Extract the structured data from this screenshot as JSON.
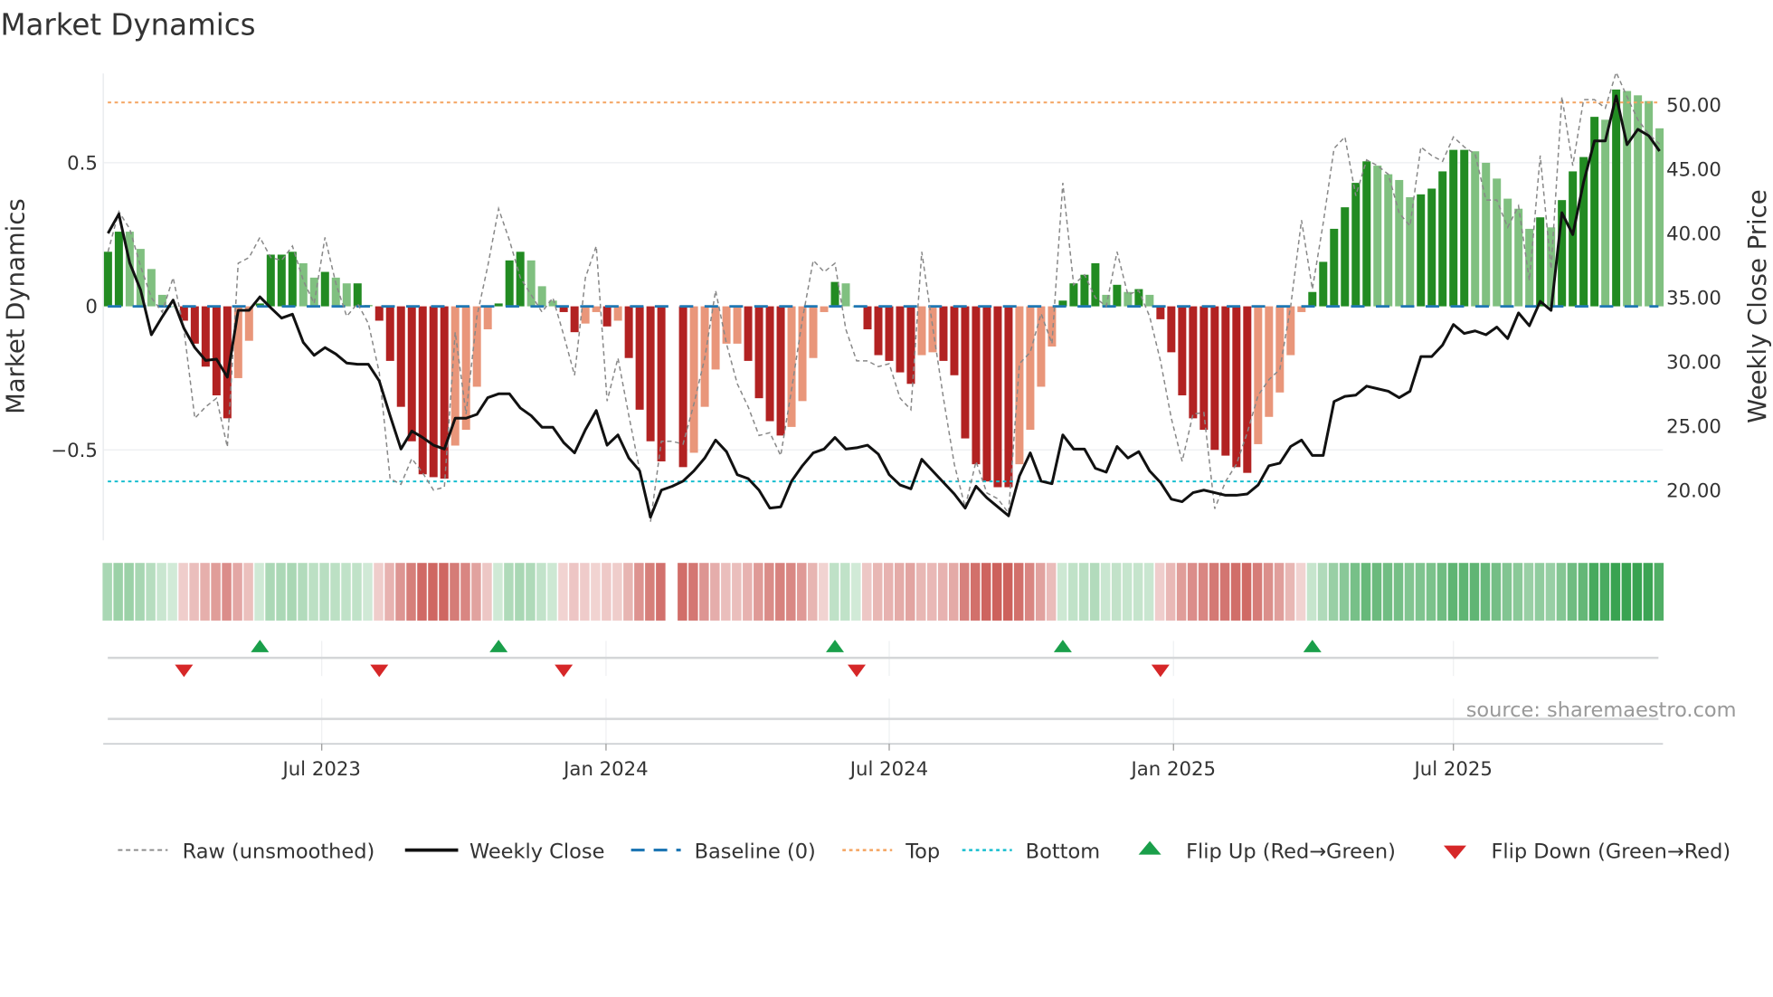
{
  "chart_data": {
    "type": "bar",
    "title": "Market Dynamics",
    "ylabel_left": "Market Dynamics",
    "ylabel_right": "Weekly Close Price",
    "left_ylim": [
      -0.81,
      0.81
    ],
    "right_ylim": [
      16.0,
      53.3
    ],
    "left_ticks": [
      {
        "value": 0.5,
        "label": "0.5"
      },
      {
        "value": 0,
        "label": "0"
      },
      {
        "value": -0.5,
        "label": "−0.5"
      }
    ],
    "right_ticks": [
      {
        "value": 50,
        "label": "50.00"
      },
      {
        "value": 45,
        "label": "45.00"
      },
      {
        "value": 40,
        "label": "40.00"
      },
      {
        "value": 35,
        "label": "35.00"
      },
      {
        "value": 30,
        "label": "30.00"
      },
      {
        "value": 25,
        "label": "25.00"
      },
      {
        "value": 20,
        "label": "20.00"
      }
    ],
    "x_ticks": [
      {
        "week": 19.7,
        "label": "Jul 2023"
      },
      {
        "week": 45.9,
        "label": "Jan 2024"
      },
      {
        "week": 72.0,
        "label": "Jul 2024"
      },
      {
        "week": 98.2,
        "label": "Jan 2025"
      },
      {
        "week": 124.0,
        "label": "Jul 2025"
      }
    ],
    "top_threshold": 0.71,
    "bottom_threshold": -0.61,
    "baseline": 0,
    "grid": true,
    "legend_position": "bottom",
    "momentum": [
      0.19,
      0.26,
      0.26,
      0.2,
      0.13,
      0.04,
      0.0,
      -0.05,
      -0.13,
      -0.21,
      -0.31,
      -0.39,
      -0.25,
      -0.12,
      0.01,
      0.18,
      0.18,
      0.19,
      0.15,
      0.1,
      0.12,
      0.1,
      0.08,
      0.08,
      0.005,
      -0.05,
      -0.19,
      -0.35,
      -0.47,
      -0.585,
      -0.595,
      -0.6,
      -0.485,
      -0.43,
      -0.28,
      -0.08,
      0.01,
      0.16,
      0.19,
      0.16,
      0.07,
      0.02,
      -0.02,
      -0.09,
      -0.06,
      -0.02,
      -0.07,
      -0.05,
      -0.18,
      -0.36,
      -0.47,
      -0.54,
      null,
      -0.56,
      -0.51,
      -0.35,
      -0.22,
      -0.13,
      -0.13,
      -0.19,
      -0.32,
      -0.4,
      -0.45,
      -0.42,
      -0.33,
      -0.18,
      -0.02,
      0.085,
      0.08,
      0.0,
      -0.08,
      -0.17,
      -0.19,
      -0.23,
      -0.27,
      -0.17,
      -0.16,
      -0.19,
      -0.24,
      -0.46,
      -0.55,
      -0.61,
      -0.63,
      -0.63,
      -0.55,
      -0.43,
      -0.28,
      -0.14,
      0.02,
      0.08,
      0.11,
      0.15,
      0.04,
      0.075,
      0.05,
      0.06,
      0.04,
      -0.045,
      -0.16,
      -0.31,
      -0.39,
      -0.43,
      -0.5,
      -0.52,
      -0.56,
      -0.58,
      -0.48,
      -0.385,
      -0.3,
      -0.17,
      -0.02,
      0.05,
      0.155,
      0.27,
      0.345,
      0.43,
      0.505,
      0.49,
      0.46,
      0.44,
      0.38,
      0.39,
      0.41,
      0.47,
      0.545,
      0.545,
      0.54,
      0.5,
      0.445,
      0.375,
      0.34,
      0.27,
      0.31,
      0.275,
      0.37,
      0.47,
      0.52,
      0.66,
      0.65,
      0.755,
      0.75,
      0.735,
      0.715,
      0.62
    ],
    "bar_shade": [
      "dg",
      "dg",
      "lg",
      "lg",
      "lg",
      "lg",
      "lg",
      "dr",
      "dr",
      "dr",
      "dr",
      "dr",
      "lr",
      "lr",
      "dg",
      "dg",
      "dg",
      "dg",
      "lg",
      "lg",
      "dg",
      "lg",
      "lg",
      "dg",
      "lg",
      "dr",
      "dr",
      "dr",
      "dr",
      "dr",
      "dr",
      "dr",
      "lr",
      "lr",
      "lr",
      "lr",
      "dg",
      "dg",
      "dg",
      "lg",
      "lg",
      "lg",
      "dr",
      "dr",
      "lr",
      "lr",
      "dr",
      "lr",
      "dr",
      "dr",
      "dr",
      "dr",
      null,
      "dr",
      "lr",
      "lr",
      "lr",
      "lr",
      "lr",
      "dr",
      "dr",
      "dr",
      "dr",
      "lr",
      "lr",
      "lr",
      "lr",
      "dg",
      "lg",
      "lg",
      "dr",
      "dr",
      "dr",
      "dr",
      "dr",
      "lr",
      "lr",
      "dr",
      "dr",
      "dr",
      "dr",
      "dr",
      "dr",
      "dr",
      "lr",
      "lr",
      "lr",
      "lr",
      "dg",
      "dg",
      "dg",
      "dg",
      "lg",
      "dg",
      "lg",
      "dg",
      "lg",
      "dr",
      "dr",
      "dr",
      "dr",
      "dr",
      "dr",
      "dr",
      "dr",
      "dr",
      "lr",
      "lr",
      "lr",
      "lr",
      "lr",
      "dg",
      "dg",
      "dg",
      "dg",
      "dg",
      "dg",
      "lg",
      "lg",
      "lg",
      "lg",
      "dg",
      "dg",
      "dg",
      "dg",
      "dg",
      "lg",
      "lg",
      "lg",
      "lg",
      "lg",
      "lg",
      "dg",
      "lg",
      "dg",
      "dg",
      "dg",
      "dg",
      "lg",
      "dg",
      "lg",
      "lg",
      "lg",
      "lg"
    ],
    "raw": [
      0.19,
      0.33,
      0.27,
      0.14,
      0.03,
      -0.02,
      0.1,
      -0.08,
      -0.39,
      -0.35,
      -0.32,
      -0.49,
      0.15,
      0.17,
      0.24,
      0.17,
      0.16,
      0.21,
      0.09,
      0.01,
      0.24,
      0.08,
      -0.035,
      0.01,
      -0.06,
      -0.23,
      -0.6,
      -0.62,
      -0.53,
      -0.58,
      -0.64,
      -0.63,
      -0.09,
      -0.375,
      -0.035,
      0.14,
      0.34,
      0.23,
      0.1,
      0.04,
      -0.02,
      0.03,
      -0.1,
      -0.24,
      0.1,
      0.21,
      -0.33,
      -0.18,
      -0.38,
      -0.57,
      -0.75,
      -0.47,
      -0.47,
      -0.48,
      -0.34,
      -0.18,
      0.055,
      -0.13,
      -0.27,
      -0.35,
      -0.45,
      -0.44,
      -0.52,
      -0.29,
      -0.045,
      0.16,
      0.12,
      0.15,
      -0.08,
      -0.19,
      -0.19,
      -0.21,
      -0.2,
      -0.32,
      -0.36,
      0.19,
      -0.07,
      -0.32,
      -0.55,
      -0.7,
      -0.54,
      -0.65,
      -0.67,
      -0.72,
      -0.2,
      -0.16,
      -0.025,
      -0.13,
      0.43,
      0.075,
      0.11,
      0.03,
      0.0,
      0.19,
      0.04,
      0.055,
      -0.035,
      -0.19,
      -0.39,
      -0.54,
      -0.375,
      -0.37,
      -0.705,
      -0.61,
      -0.55,
      -0.44,
      -0.31,
      -0.255,
      -0.22,
      0.0,
      0.3,
      0.06,
      0.29,
      0.55,
      0.59,
      0.385,
      0.51,
      0.49,
      0.46,
      0.325,
      0.28,
      0.555,
      0.525,
      0.505,
      0.59,
      0.555,
      0.53,
      0.37,
      0.37,
      0.275,
      0.35,
      0.09,
      0.525,
      0.13,
      0.73,
      0.49,
      0.72,
      0.72,
      0.69,
      0.815,
      0.73,
      0.65,
      0.6,
      0.565
    ],
    "weekly_close": [
      40.0,
      41.5,
      37.7,
      35.6,
      32.1,
      33.5,
      34.8,
      32.6,
      31.1,
      30.1,
      30.2,
      28.8,
      34.0,
      34.0,
      35.05,
      34.2,
      33.4,
      33.7,
      31.5,
      30.5,
      31.1,
      30.6,
      29.9,
      29.8,
      29.8,
      28.5,
      25.8,
      23.2,
      24.6,
      24.1,
      23.5,
      23.2,
      25.6,
      25.6,
      25.9,
      27.2,
      27.5,
      27.5,
      26.4,
      25.8,
      24.9,
      24.9,
      23.7,
      22.9,
      24.7,
      26.2,
      23.5,
      24.3,
      22.5,
      21.5,
      17.9,
      20.0,
      20.3,
      20.7,
      21.5,
      22.5,
      23.9,
      23.0,
      21.2,
      20.9,
      20.0,
      18.6,
      18.7,
      20.7,
      21.9,
      22.9,
      23.2,
      24.1,
      23.2,
      23.3,
      23.5,
      22.8,
      21.2,
      20.4,
      20.1,
      22.4,
      21.5,
      20.6,
      19.7,
      18.6,
      20.3,
      19.4,
      18.7,
      18.0,
      21.1,
      22.9,
      20.7,
      20.5,
      24.3,
      23.2,
      23.2,
      21.7,
      21.4,
      23.4,
      22.5,
      23.0,
      21.5,
      20.6,
      19.3,
      19.1,
      19.8,
      20.0,
      19.8,
      19.6,
      19.6,
      19.7,
      20.4,
      21.9,
      22.1,
      23.4,
      23.9,
      22.7,
      22.7,
      26.9,
      27.3,
      27.4,
      28.1,
      27.9,
      27.7,
      27.2,
      27.7,
      30.4,
      30.4,
      31.3,
      32.9,
      32.2,
      32.4,
      32.1,
      32.7,
      31.8,
      33.8,
      32.8,
      34.7,
      34.0,
      41.6,
      39.9,
      44.0,
      47.2,
      47.2,
      50.7,
      46.9,
      48.1,
      47.6,
      46.4
    ],
    "flips_up": [
      14,
      36,
      67,
      88,
      111
    ],
    "flips_down": [
      7,
      25,
      42,
      69,
      97
    ],
    "colors": {
      "dark_green": "#228b22",
      "light_green": "#80c080",
      "dark_red": "#b22222",
      "light_red": "#e9967a",
      "close": "#111111",
      "raw": "#888888",
      "baseline": "#1f77b4",
      "top": "#f4a460",
      "bottom": "#17becf",
      "flip_up": "#1a9f4a",
      "flip_down": "#d62728",
      "strip_green": "#2e9e48",
      "strip_red": "#c4453f"
    },
    "legend": {
      "raw": "Raw (unsmoothed)",
      "close": "Weekly Close",
      "baseline": "Baseline (0)",
      "top": "Top",
      "bottom": "Bottom",
      "flip_up": "Flip Up (Red→Green)",
      "flip_down": "Flip Down (Green→Red)"
    },
    "source": "source: sharemaestro.com"
  }
}
